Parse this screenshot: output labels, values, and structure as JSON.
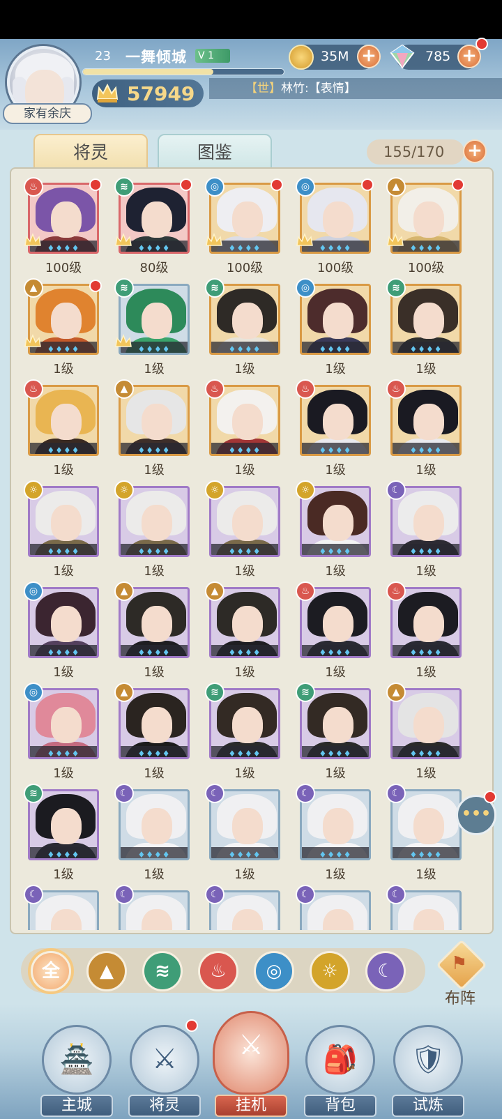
{
  "player": {
    "level": "23",
    "name": "一舞倾城",
    "vip": "V 1",
    "exp_ratio": 0.65,
    "title": "家有余庆",
    "power": "57949"
  },
  "currency": {
    "coins": "35M",
    "gems": "785"
  },
  "chat": {
    "channel": "【世】",
    "message": "林竹:【表情】"
  },
  "tabs": {
    "active": "将灵",
    "inactive": "图鉴"
  },
  "capacity": "155/170",
  "element_colors": {
    "fire": "#d9574f",
    "wind": "#3f9d77",
    "water": "#3d8fc7",
    "earth": "#c58b34",
    "light": "#d3a42a",
    "dark": "#7a63b8"
  },
  "cards": [
    {
      "level": "100级",
      "element": "fire",
      "quality": "red",
      "dot": true,
      "crest": true,
      "hair": "#7b55a8",
      "robe": "#8a3b3b"
    },
    {
      "level": "80级",
      "element": "wind",
      "quality": "red",
      "dot": true,
      "crest": true,
      "hair": "#1e2232",
      "robe": "#2f3a3a"
    },
    {
      "level": "100级",
      "element": "water",
      "quality": "gold",
      "dot": true,
      "crest": true,
      "hair": "#eeeef2",
      "robe": "#dcdde6"
    },
    {
      "level": "100级",
      "element": "water",
      "quality": "gold",
      "dot": true,
      "crest": true,
      "hair": "#e6e7ef",
      "robe": "#cfd2de"
    },
    {
      "level": "100级",
      "element": "earth",
      "quality": "gold",
      "dot": true,
      "crest": true,
      "hair": "#f2efe8",
      "robe": "#d6b56e"
    },
    {
      "level": "1级",
      "element": "earth",
      "quality": "gold",
      "dot": true,
      "crest": true,
      "hair": "#e0832f",
      "robe": "#c45a2a"
    },
    {
      "level": "1级",
      "element": "wind",
      "quality": "blue",
      "dot": false,
      "crest": true,
      "hair": "#2d8a5a",
      "robe": "#3aa36b"
    },
    {
      "level": "1级",
      "element": "wind",
      "quality": "gold",
      "dot": false,
      "crest": false,
      "hair": "#2e2a26",
      "robe": "#e8e4da"
    },
    {
      "level": "1级",
      "element": "water",
      "quality": "gold",
      "dot": false,
      "crest": false,
      "hair": "#4d2c2c",
      "robe": "#3a3a58"
    },
    {
      "level": "1级",
      "element": "wind",
      "quality": "gold",
      "dot": false,
      "crest": false,
      "hair": "#3a2f28",
      "robe": "#2e2e2e"
    },
    {
      "level": "1级",
      "element": "fire",
      "quality": "gold",
      "dot": false,
      "crest": false,
      "hair": "#e9b552",
      "robe": "#3a2a22"
    },
    {
      "level": "1级",
      "element": "earth",
      "quality": "gold",
      "dot": false,
      "crest": false,
      "hair": "#e6e6e6",
      "robe": "#3e2f2a"
    },
    {
      "level": "1级",
      "element": "fire",
      "quality": "gold",
      "dot": false,
      "crest": false,
      "hair": "#f3f1ee",
      "robe": "#a33636"
    },
    {
      "level": "1级",
      "element": "fire",
      "quality": "gold",
      "dot": false,
      "crest": false,
      "hair": "#1a1a22",
      "robe": "#e9e9ee"
    },
    {
      "level": "1级",
      "element": "fire",
      "quality": "gold",
      "dot": false,
      "crest": false,
      "hair": "#1a1a22",
      "robe": "#e9e9ee"
    },
    {
      "level": "1级",
      "element": "light",
      "quality": "purple",
      "dot": false,
      "crest": false,
      "hair": "#ecebea",
      "robe": "#7a6a4a"
    },
    {
      "level": "1级",
      "element": "light",
      "quality": "purple",
      "dot": false,
      "crest": false,
      "hair": "#ecebea",
      "robe": "#7a6a4a"
    },
    {
      "level": "1级",
      "element": "light",
      "quality": "purple",
      "dot": false,
      "crest": false,
      "hair": "#ecebea",
      "robe": "#7a6a4a"
    },
    {
      "level": "1级",
      "element": "light",
      "quality": "purple",
      "dot": false,
      "crest": false,
      "hair": "#4a2a24",
      "robe": "#f3f3f3"
    },
    {
      "level": "1级",
      "element": "dark",
      "quality": "purple",
      "dot": false,
      "crest": false,
      "hair": "#ececec",
      "robe": "#2d2b33"
    },
    {
      "level": "1级",
      "element": "water",
      "quality": "purple",
      "dot": false,
      "crest": false,
      "hair": "#3b2530",
      "robe": "#54405e"
    },
    {
      "level": "1级",
      "element": "earth",
      "quality": "purple",
      "dot": false,
      "crest": false,
      "hair": "#2d2a26",
      "robe": "#1f1e22"
    },
    {
      "level": "1级",
      "element": "earth",
      "quality": "purple",
      "dot": false,
      "crest": false,
      "hair": "#2d2a26",
      "robe": "#1f1e22"
    },
    {
      "level": "1级",
      "element": "fire",
      "quality": "purple",
      "dot": false,
      "crest": false,
      "hair": "#1c1c22",
      "robe": "#2a2a33"
    },
    {
      "level": "1级",
      "element": "fire",
      "quality": "purple",
      "dot": false,
      "crest": false,
      "hair": "#1c1c22",
      "robe": "#2a2a33"
    },
    {
      "level": "1级",
      "element": "water",
      "quality": "purple",
      "dot": false,
      "crest": false,
      "hair": "#e0899a",
      "robe": "#c46a80"
    },
    {
      "level": "1级",
      "element": "earth",
      "quality": "purple",
      "dot": false,
      "crest": false,
      "hair": "#2a2420",
      "robe": "#1c1c1c"
    },
    {
      "level": "1级",
      "element": "wind",
      "quality": "purple",
      "dot": false,
      "crest": false,
      "hair": "#332a24",
      "robe": "#2a2a2a"
    },
    {
      "level": "1级",
      "element": "wind",
      "quality": "purple",
      "dot": false,
      "crest": false,
      "hair": "#332a24",
      "robe": "#2a2a2a"
    },
    {
      "level": "1级",
      "element": "earth",
      "quality": "purple",
      "dot": false,
      "crest": false,
      "hair": "#e4e4e4",
      "robe": "#2a2a2a"
    },
    {
      "level": "1级",
      "element": "wind",
      "quality": "purple",
      "dot": false,
      "crest": false,
      "hair": "#1b1b20",
      "robe": "#2a2a33"
    },
    {
      "level": "1级",
      "element": "dark",
      "quality": "blue",
      "dot": false,
      "crest": false,
      "hair": "#f0f0f2",
      "robe": "#f5f5f7"
    },
    {
      "level": "1级",
      "element": "dark",
      "quality": "blue",
      "dot": false,
      "crest": false,
      "hair": "#f0f0f2",
      "robe": "#f5f5f7"
    },
    {
      "level": "1级",
      "element": "dark",
      "quality": "blue",
      "dot": false,
      "crest": false,
      "hair": "#f0f0f2",
      "robe": "#f5f5f7"
    },
    {
      "level": "1级",
      "element": "dark",
      "quality": "blue",
      "dot": false,
      "crest": false,
      "hair": "#f0f0f2",
      "robe": "#f5f5f7"
    },
    {
      "level": "",
      "element": "dark",
      "quality": "blue",
      "dot": false,
      "crest": false,
      "hair": "#f0f0f2",
      "robe": "#f5f5f7"
    },
    {
      "level": "",
      "element": "dark",
      "quality": "blue",
      "dot": false,
      "crest": false,
      "hair": "#f0f0f2",
      "robe": "#f5f5f7"
    },
    {
      "level": "",
      "element": "dark",
      "quality": "blue",
      "dot": false,
      "crest": false,
      "hair": "#f0f0f2",
      "robe": "#f5f5f7"
    },
    {
      "level": "",
      "element": "dark",
      "quality": "blue",
      "dot": false,
      "crest": false,
      "hair": "#f0f0f2",
      "robe": "#f5f5f7"
    },
    {
      "level": "",
      "element": "dark",
      "quality": "blue",
      "dot": false,
      "crest": false,
      "hair": "#f0f0f2",
      "robe": "#f5f5f7"
    }
  ],
  "filters": [
    {
      "id": "all",
      "label": "全"
    },
    {
      "id": "earth",
      "icon": "mountain-icon"
    },
    {
      "id": "wind",
      "icon": "whirlwind-icon"
    },
    {
      "id": "fire",
      "icon": "flame-icon"
    },
    {
      "id": "water",
      "icon": "wave-icon"
    },
    {
      "id": "light",
      "icon": "sun-icon"
    },
    {
      "id": "dark",
      "icon": "moon-icon"
    }
  ],
  "formation_label": "布阵",
  "nav": [
    {
      "label": "主城",
      "dot": false
    },
    {
      "label": "将灵",
      "dot": true
    },
    {
      "label": "挂机",
      "dot": false,
      "center": true
    },
    {
      "label": "背包",
      "dot": false
    },
    {
      "label": "试炼",
      "dot": false
    }
  ]
}
